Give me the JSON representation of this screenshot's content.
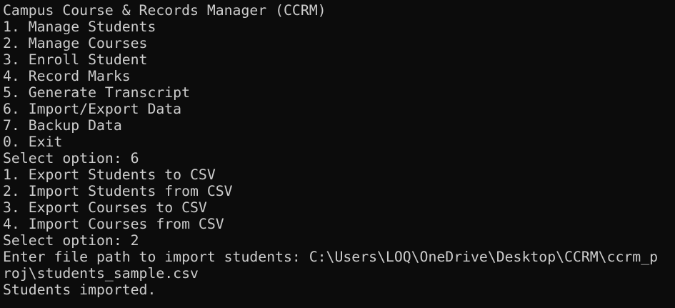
{
  "terminal": {
    "lines": [
      "Campus Course & Records Manager (CCRM)",
      "1. Manage Students",
      "2. Manage Courses",
      "3. Enroll Student",
      "4. Record Marks",
      "5. Generate Transcript",
      "6. Import/Export Data",
      "7. Backup Data",
      "0. Exit",
      "Select option: 6",
      "1. Export Students to CSV",
      "2. Import Students from CSV",
      "3. Export Courses to CSV",
      "4. Import Courses from CSV",
      "Select option: 2",
      "Enter file path to import students: C:\\Users\\LOQ\\OneDrive\\Desktop\\CCRM\\ccrm_p",
      "roj\\students_sample.csv",
      "Students imported."
    ]
  },
  "colors": {
    "background": "#0c0c0c",
    "foreground": "#cccccc"
  }
}
